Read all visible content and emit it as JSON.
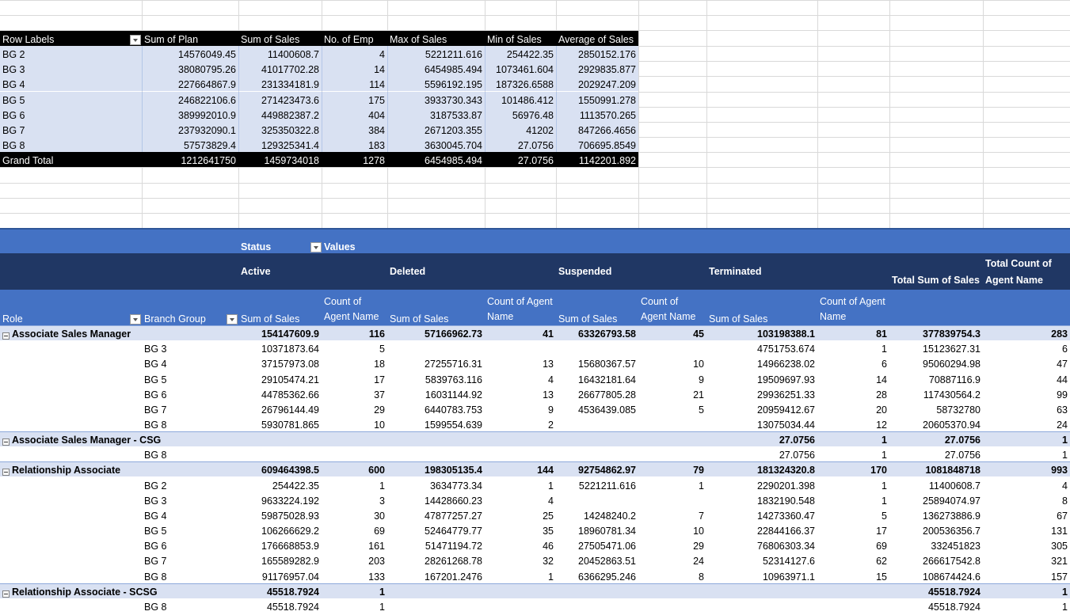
{
  "pivot1": {
    "headers": [
      "Row Labels",
      "Sum of Plan",
      "Sum of Sales",
      "No. of Emp",
      "Max of Sales",
      "Min of Sales",
      "Average of Sales"
    ],
    "rows": [
      [
        "BG 2",
        "14576049.45",
        "11400608.7",
        "4",
        "5221211.616",
        "254422.35",
        "2850152.176"
      ],
      [
        "BG 3",
        "38080795.26",
        "41017702.28",
        "14",
        "6454985.494",
        "1073461.604",
        "2929835.877"
      ],
      [
        "BG 4",
        "227664867.9",
        "231334181.9",
        "114",
        "5596192.195",
        "187326.6588",
        "2029247.209"
      ],
      [
        "BG 5",
        "246822106.6",
        "271423473.6",
        "175",
        "3933730.343",
        "101486.412",
        "1550991.278"
      ],
      [
        "BG 6",
        "389992010.9",
        "449882387.2",
        "404",
        "3187533.87",
        "56976.48",
        "1113570.265"
      ],
      [
        "BG 7",
        "237932090.1",
        "325350322.8",
        "384",
        "2671203.355",
        "41202",
        "847266.4656"
      ],
      [
        "BG 8",
        "57573829.4",
        "129325341.4",
        "183",
        "3630045.704",
        "27.0756",
        "706695.8549"
      ]
    ],
    "grand_total": [
      "Grand Total",
      "1212641750",
      "1459734018",
      "1278",
      "6454985.494",
      "27.0756",
      "1142201.892"
    ]
  },
  "pivot2": {
    "status_label": "Status",
    "values_label": "Values",
    "statuses": [
      "Active",
      "Deleted",
      "Suspended",
      "Terminated"
    ],
    "total_sum_label": "Total Sum of Sales",
    "total_count_label": "Total Count of Agent Name",
    "role_label": "Role",
    "branch_label": "Branch Group",
    "sum_label": "Sum of Sales",
    "count_label": "Count of Agent Name",
    "rows": [
      {
        "type": "role",
        "label": "Associate Sales Manager",
        "v": [
          "154147609.9",
          "116",
          "57166962.73",
          "41",
          "63326793.58",
          "45",
          "103198388.1",
          "81",
          "377839754.3",
          "283"
        ]
      },
      {
        "type": "bg",
        "label": "BG 3",
        "v": [
          "10371873.64",
          "5",
          "",
          "",
          "",
          "",
          "4751753.674",
          "1",
          "15123627.31",
          "6"
        ]
      },
      {
        "type": "bg",
        "label": "BG 4",
        "v": [
          "37157973.08",
          "18",
          "27255716.31",
          "13",
          "15680367.57",
          "10",
          "14966238.02",
          "6",
          "95060294.98",
          "47"
        ]
      },
      {
        "type": "bg",
        "label": "BG 5",
        "v": [
          "29105474.21",
          "17",
          "5839763.116",
          "4",
          "16432181.64",
          "9",
          "19509697.93",
          "14",
          "70887116.9",
          "44"
        ]
      },
      {
        "type": "bg",
        "label": "BG 6",
        "v": [
          "44785362.66",
          "37",
          "16031144.92",
          "13",
          "26677805.28",
          "21",
          "29936251.33",
          "28",
          "117430564.2",
          "99"
        ]
      },
      {
        "type": "bg",
        "label": "BG 7",
        "v": [
          "26796144.49",
          "29",
          "6440783.753",
          "9",
          "4536439.085",
          "5",
          "20959412.67",
          "20",
          "58732780",
          "63"
        ]
      },
      {
        "type": "bg",
        "label": "BG 8",
        "v": [
          "5930781.865",
          "10",
          "1599554.639",
          "2",
          "",
          "",
          "13075034.44",
          "12",
          "20605370.94",
          "24"
        ]
      },
      {
        "type": "role",
        "label": "Associate Sales Manager - CSG",
        "v": [
          "",
          "",
          "",
          "",
          "",
          "",
          "27.0756",
          "1",
          "27.0756",
          "1"
        ]
      },
      {
        "type": "bg",
        "label": "BG 8",
        "v": [
          "",
          "",
          "",
          "",
          "",
          "",
          "27.0756",
          "1",
          "27.0756",
          "1"
        ]
      },
      {
        "type": "role",
        "label": "Relationship Associate",
        "v": [
          "609464398.5",
          "600",
          "198305135.4",
          "144",
          "92754862.97",
          "79",
          "181324320.8",
          "170",
          "1081848718",
          "993"
        ]
      },
      {
        "type": "bg",
        "label": "BG 2",
        "v": [
          "254422.35",
          "1",
          "3634773.34",
          "1",
          "5221211.616",
          "1",
          "2290201.398",
          "1",
          "11400608.7",
          "4"
        ]
      },
      {
        "type": "bg",
        "label": "BG 3",
        "v": [
          "9633224.192",
          "3",
          "14428660.23",
          "4",
          "",
          "",
          "1832190.548",
          "1",
          "25894074.97",
          "8"
        ]
      },
      {
        "type": "bg",
        "label": "BG 4",
        "v": [
          "59875028.93",
          "30",
          "47877257.27",
          "25",
          "14248240.2",
          "7",
          "14273360.47",
          "5",
          "136273886.9",
          "67"
        ]
      },
      {
        "type": "bg",
        "label": "BG 5",
        "v": [
          "106266629.2",
          "69",
          "52464779.77",
          "35",
          "18960781.34",
          "10",
          "22844166.37",
          "17",
          "200536356.7",
          "131"
        ]
      },
      {
        "type": "bg",
        "label": "BG 6",
        "v": [
          "176668853.9",
          "161",
          "51471194.72",
          "46",
          "27505471.06",
          "29",
          "76806303.34",
          "69",
          "332451823",
          "305"
        ]
      },
      {
        "type": "bg",
        "label": "BG 7",
        "v": [
          "165589282.9",
          "203",
          "28261268.78",
          "32",
          "20452863.51",
          "24",
          "52314127.6",
          "62",
          "266617542.8",
          "321"
        ]
      },
      {
        "type": "bg",
        "label": "BG 8",
        "v": [
          "91176957.04",
          "133",
          "167201.2476",
          "1",
          "6366295.246",
          "8",
          "10963971.1",
          "15",
          "108674424.6",
          "157"
        ]
      },
      {
        "type": "role",
        "label": "Relationship Associate - SCSG",
        "v": [
          "45518.7924",
          "1",
          "",
          "",
          "",
          "",
          "",
          "",
          "45518.7924",
          "1"
        ]
      },
      {
        "type": "bg",
        "label": "BG 8",
        "v": [
          "45518.7924",
          "1",
          "",
          "",
          "",
          "",
          "",
          "",
          "45518.7924",
          "1"
        ]
      }
    ]
  }
}
